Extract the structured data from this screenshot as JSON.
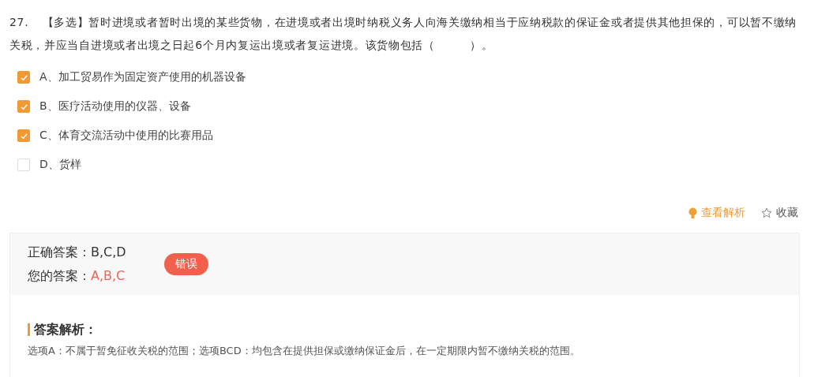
{
  "question": {
    "number": "27.",
    "text": "【多选】暂时进境或者暂时出境的某些货物，在进境或者出境时纳税义务人向海关缴纳相当于应纳税款的保证金或者提供其他担保的，可以暂不缴纳关税，并应当自进境或者出境之日起6个月内复运出境或者复运进境。该货物包括（　　　）。"
  },
  "options": [
    {
      "label": "A、加工贸易作为固定资产使用的机器设备",
      "checked": true
    },
    {
      "label": "B、医疗活动使用的仪器、设备",
      "checked": true
    },
    {
      "label": "C、体育交流活动中使用的比赛用品",
      "checked": true
    },
    {
      "label": "D、货样",
      "checked": false
    }
  ],
  "actions": {
    "analysis": "查看解析",
    "favorite": "收藏"
  },
  "result": {
    "correct_label": "正确答案：",
    "correct": "B,C,D",
    "yours_label": "您的答案：",
    "yours": "A,B,C",
    "status": "错误",
    "is_correct": false
  },
  "explanation": {
    "title": "答案解析：",
    "text": "选项A：不属于暂免征收关税的范围；选项BCD：均包含在提供担保或缴纳保证金后，在一定期限内暂不缴纳关税的范围。"
  }
}
